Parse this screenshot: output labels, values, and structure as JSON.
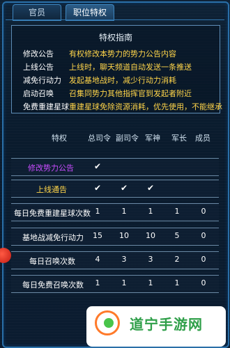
{
  "tabs": [
    {
      "label": "官员"
    },
    {
      "label": "职位特权"
    }
  ],
  "guide": {
    "title": "特权指南",
    "items": [
      {
        "name": "修改公告",
        "desc": "有权修改本势力的势力公告内容"
      },
      {
        "name": "上线公告",
        "desc": "上线时，聊天频道自动发送一条推送"
      },
      {
        "name": "减免行动力",
        "desc": "发起基地战时，减少行动力消耗"
      },
      {
        "name": "启动召唤",
        "desc": "召集同势力其他指挥官到发起者附近"
      },
      {
        "name": "免费重建星球",
        "desc": "重建星球免除资源消耗，优先使用，不能继承"
      }
    ]
  },
  "table": {
    "headers": [
      "特权",
      "总司令",
      "副司令",
      "军神",
      "军长",
      "成员"
    ],
    "rows": [
      {
        "label": "修改势力公告",
        "label_color": "#c94cff",
        "values": [
          "✔",
          "",
          "",
          "",
          ""
        ]
      },
      {
        "label": "上线通告",
        "label_color": "#ffd54a",
        "values": [
          "✔",
          "✔",
          "✔",
          "",
          ""
        ]
      },
      {
        "label": "每日免费重建星球次数",
        "label_color": "#ffffff",
        "values": [
          "1",
          "1",
          "1",
          "1",
          "0"
        ]
      },
      {
        "label": "基地战减免行动力",
        "label_color": "#ffffff",
        "values": [
          "15",
          "10",
          "10",
          "5",
          "0"
        ]
      },
      {
        "label": "每日召唤次数",
        "label_color": "#ffffff",
        "values": [
          "4",
          "3",
          "3",
          "2",
          "0"
        ]
      },
      {
        "label": "每日免费召唤次数",
        "label_color": "#ffffff",
        "values": [
          "1",
          "1",
          "1",
          "1",
          "0"
        ]
      }
    ]
  },
  "watermark": {
    "text": "道宁手游网"
  }
}
